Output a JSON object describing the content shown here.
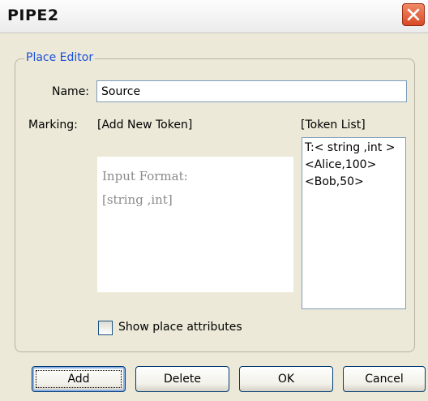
{
  "window": {
    "title": "PIPE2"
  },
  "group": {
    "legend": "Place Editor"
  },
  "name": {
    "label": "Name:",
    "value": "Source"
  },
  "marking": {
    "label": "Marking:",
    "add_token_label": "[Add New Token]",
    "token_list_label": "[Token List]"
  },
  "input_area": {
    "line1": "Input Format:",
    "line2": "[string ,int]"
  },
  "token_list": {
    "items": [
      "T:< string ,int >",
      "<Alice,100>",
      "<Bob,50>"
    ]
  },
  "show_attributes": {
    "label": "Show place attributes",
    "checked": false
  },
  "buttons": {
    "add": "Add",
    "delete": "Delete",
    "ok": "OK",
    "cancel": "Cancel"
  },
  "colors": {
    "legend": "#1a4fd8",
    "input_text": "#8a8a8a",
    "close_button": "#d84a24"
  },
  "icons": {
    "close": "close-icon"
  }
}
